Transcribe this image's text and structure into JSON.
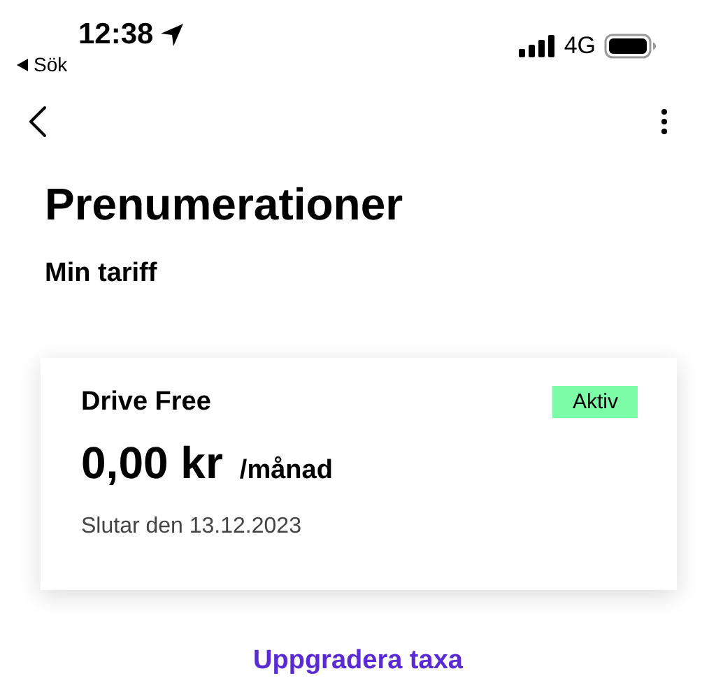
{
  "status_bar": {
    "time": "12:38",
    "back_label": "Sök",
    "network": "4G"
  },
  "title": "Prenumerationer",
  "section_title": "Min tariff",
  "plan": {
    "name": "Drive Free",
    "status": "Aktiv",
    "price": "0,00 kr",
    "period": "/månad",
    "end_note": "Slutar den 13.12.2023"
  },
  "upgrade_link": "Uppgradera taxa"
}
